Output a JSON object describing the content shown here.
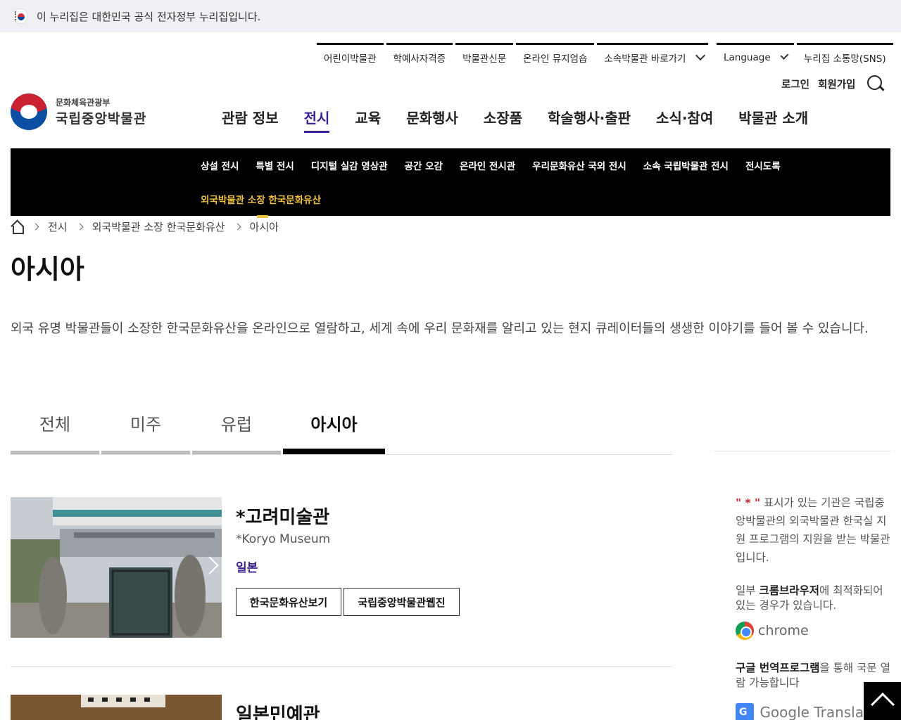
{
  "gov_banner": {
    "text": "이 누리집은 대한민국 공식 전자정부 누리집입니다."
  },
  "util_nav": {
    "items": [
      "어린이박물관",
      "학예사자격증",
      "박물관신문",
      "온라인 뮤지엄숍",
      "소속박물관 바로가기"
    ],
    "language": "Language",
    "sns": "누리집 소통망(SNS)"
  },
  "account": {
    "login": "로그인",
    "signup": "회원가입"
  },
  "logo": {
    "ministry": "문화체육관광부",
    "name": "국립중앙박물관"
  },
  "gnb": [
    "관람 정보",
    "전시",
    "교육",
    "문화행사",
    "소장품",
    "학술행사·출판",
    "소식·참여",
    "박물관 소개"
  ],
  "gnb_active": "전시",
  "subnav": {
    "row1": [
      "상설 전시",
      "특별 전시",
      "디지털 실감 영상관",
      "공간 오감",
      "온라인 전시관",
      "우리문화유산 국외 전시",
      "소속 국립박물관 전시",
      "전시도록"
    ],
    "row2": [
      "외국박물관 소장 한국문화유산"
    ]
  },
  "breadcrumb": [
    "전시",
    "외국박물관 소장 한국문화유산",
    "아시아"
  ],
  "page_title": "아시아",
  "intro": "외국 유명 박물관들이 소장한 한국문화유산을 온라인으로 열람하고, 세계 속에 우리 문화재를 알리고 있는 현지 큐레이터들의 생생한 이야기를 들어 볼 수 있습니다.",
  "tabs": [
    "전체",
    "미주",
    "유럽",
    "아시아"
  ],
  "tab_active": "아시아",
  "museums": [
    {
      "title": "*고려미술관",
      "subtitle": "*Koryo Museum",
      "country": "일본",
      "buttons": [
        "한국문화유산보기",
        "국립중앙박물관웹진"
      ]
    },
    {
      "title": "일본민예관"
    }
  ],
  "aside": {
    "note_mark": "\" * \"",
    "note": " 표시가 있는 기관은 국립중앙박물관의 외국박물관 한국실 지원 프로그램의 지원을 받는 박물관 입니다.",
    "browser_prefix": "일부 ",
    "browser_bold": "크롬브라우저",
    "browser_suffix": "에 최적화되어 있는 경우가 있습니다.",
    "chrome_label": "chrome",
    "translate_bold": "구글 번역프로그램",
    "translate_suffix": "을 통해 국문 열람 가능합니다",
    "translate_label": "Google Transla"
  },
  "colors": {
    "accent": "#3b1e8f",
    "subnav_active": "#f0c040",
    "subnav_bg": "#000000"
  }
}
